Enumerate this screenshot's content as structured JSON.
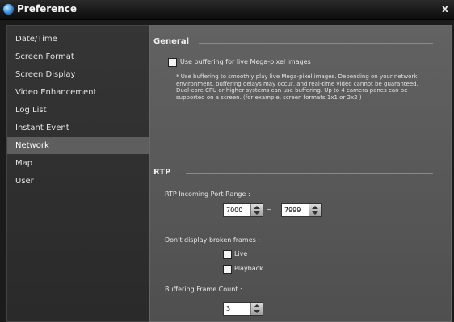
{
  "window": {
    "title": "Preference",
    "close_label": "x"
  },
  "sidebar": {
    "items": [
      {
        "label": "Date/Time"
      },
      {
        "label": "Screen Format"
      },
      {
        "label": "Screen Display"
      },
      {
        "label": "Video Enhancement"
      },
      {
        "label": "Log List"
      },
      {
        "label": "Instant Event"
      },
      {
        "label": "Network",
        "selected": true
      },
      {
        "label": "Map"
      },
      {
        "label": "User"
      }
    ]
  },
  "general": {
    "title": "General",
    "buffering_label": "Use buffering for live Mega-pixel images",
    "buffering_checked": false,
    "note": "* Use buffering to smoothly play live Mega-pixel images. Depending on your network environment, buffering delays may occur, and real-time video cannot be guaranteed. Dual-core CPU or higher systems can use buffering. Up to 4 camera panes can be supported on a screen. (for example, screen formats 1x1 or 2x2 )"
  },
  "rtp": {
    "title": "RTP",
    "port_range_label": "RTP Incoming Port Range :",
    "port_from": "7000",
    "port_separator": "~",
    "port_to": "7999",
    "broken_frames_label": "Don't display broken frames :",
    "live_label": "Live",
    "live_checked": false,
    "playback_label": "Playback",
    "playback_checked": false,
    "buffer_count_label": "Buffering Frame Count :",
    "buffer_count": "3"
  },
  "colors": {
    "titlebar": "#111111",
    "sidebar": "#303030",
    "sidebar_selected": "#5e5e5e",
    "content": "#585858",
    "icon_blue": "#2a83d8"
  },
  "icons": {
    "app": "app-globe-icon",
    "close": "close-icon"
  }
}
